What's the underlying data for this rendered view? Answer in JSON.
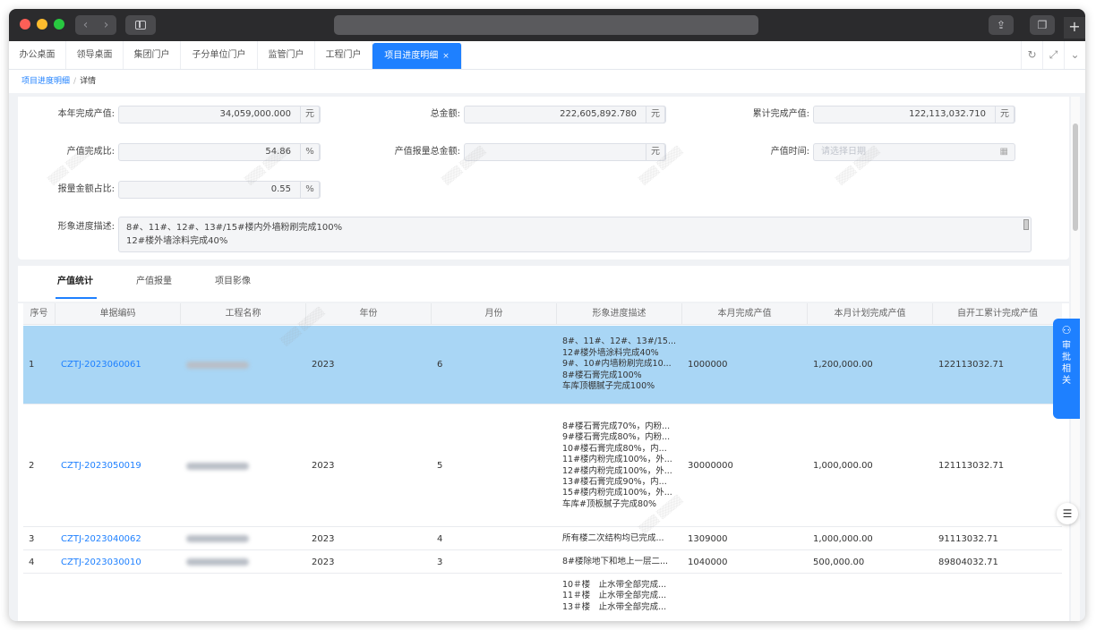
{
  "browser": {
    "nav_back": "‹",
    "nav_forward": "›",
    "share_icon": "share-icon",
    "tabs_icon": "tabs-icon",
    "new_tab": "+"
  },
  "app_tabs": [
    {
      "label": "办公桌面"
    },
    {
      "label": "领导桌面"
    },
    {
      "label": "集团门户"
    },
    {
      "label": "子分单位门户"
    },
    {
      "label": "监管门户"
    },
    {
      "label": "工程门户"
    },
    {
      "label": "项目进度明细",
      "active": true,
      "close": "×"
    }
  ],
  "tab_tools": {
    "refresh": "↻",
    "fullscreen": "⤢",
    "more": "⌄"
  },
  "breadcrumb": {
    "parent": "项目进度明细",
    "separator": "/",
    "current": "详情"
  },
  "form": {
    "annual_output_label": "本年完成产值:",
    "annual_output_value": "34,059,000.000",
    "annual_output_unit": "元",
    "total_amount_label": "总金额:",
    "total_amount_value": "222,605,892.780",
    "total_amount_unit": "元",
    "cumulative_output_label": "累计完成产值:",
    "cumulative_output_value": "122,113,032.710",
    "cumulative_output_unit": "元",
    "completion_ratio_label": "产值完成比:",
    "completion_ratio_value": "54.86",
    "completion_ratio_unit": "%",
    "reported_total_label": "产值报量总金额:",
    "reported_total_value": "",
    "reported_total_unit": "元",
    "output_time_label": "产值时间:",
    "output_time_placeholder": "请选择日期",
    "report_ratio_label": "报量金额占比:",
    "report_ratio_value": "0.55",
    "report_ratio_unit": "%",
    "progress_desc_label": "形象进度描述:",
    "progress_desc_line1": "8#、11#、12#、13#/15#楼内外墙粉刷完成100%",
    "progress_desc_line2": "12#楼外墙涂料完成40%"
  },
  "inner_tabs": [
    {
      "label": "产值统计",
      "active": true
    },
    {
      "label": "产值报量"
    },
    {
      "label": "项目影像"
    }
  ],
  "table": {
    "columns": [
      "序号",
      "单据编码",
      "工程名称",
      "年份",
      "月份",
      "形象进度描述",
      "本月完成产值",
      "本月计划完成产值",
      "自开工累计完成产值"
    ],
    "rows": [
      {
        "index": "1",
        "code": "CZTJ-2023060061",
        "project": "",
        "year": "2023",
        "month": "6",
        "desc": [
          "8#、11#、12#、13#/15...",
          "12#楼外墙涂料完成40%",
          "9#、10#内墙粉刷完成10...",
          "8#楼石膏完成100%",
          "车库顶棚腻子完成100%"
        ],
        "month_output": "1000000",
        "month_plan": "1,200,000.00",
        "cumulative": "122113032.71"
      },
      {
        "index": "2",
        "code": "CZTJ-2023050019",
        "project": "",
        "year": "2023",
        "month": "5",
        "desc": [
          "8#楼石膏完成70%，内粉...",
          "9#楼石膏完成80%，内粉...",
          "10#楼石膏完成80%，内...",
          "11#楼内粉完成100%，外...",
          "12#楼内粉完成100%，外...",
          "13#楼石膏完成90%，内...",
          "15#楼内粉完成100%，外...",
          "车库#顶板腻子完成80%"
        ],
        "month_output": "30000000",
        "month_plan": "1,000,000.00",
        "cumulative": "121113032.71"
      },
      {
        "index": "3",
        "code": "CZTJ-2023040062",
        "project": "",
        "year": "2023",
        "month": "4",
        "desc": [
          "所有楼二次结构均已完成..."
        ],
        "month_output": "1309000",
        "month_plan": "1,000,000.00",
        "cumulative": "91113032.71"
      },
      {
        "index": "4",
        "code": "CZTJ-2023030010",
        "project": "",
        "year": "2023",
        "month": "3",
        "desc": [
          "8#楼除地下和地上一层二..."
        ],
        "month_output": "1040000",
        "month_plan": "500,000.00",
        "cumulative": "89804032.71"
      },
      {
        "index": "",
        "code": "",
        "project": "",
        "year": "",
        "month": "",
        "desc": [
          "10＃楼　止水带全部完成...",
          "11＃楼　止水带全部完成...",
          "13＃楼　止水带全部完成..."
        ],
        "month_output": "",
        "month_plan": "",
        "cumulative": ""
      }
    ]
  },
  "side_panel": {
    "icon": "sitemap-icon",
    "chars": [
      "审",
      "批",
      "相",
      "关"
    ]
  },
  "settings_icon": "sliders-icon",
  "colors": {
    "primary": "#1e80ff",
    "selected_row": "#a9d6f5",
    "titlebar": "#2b2b2d"
  }
}
